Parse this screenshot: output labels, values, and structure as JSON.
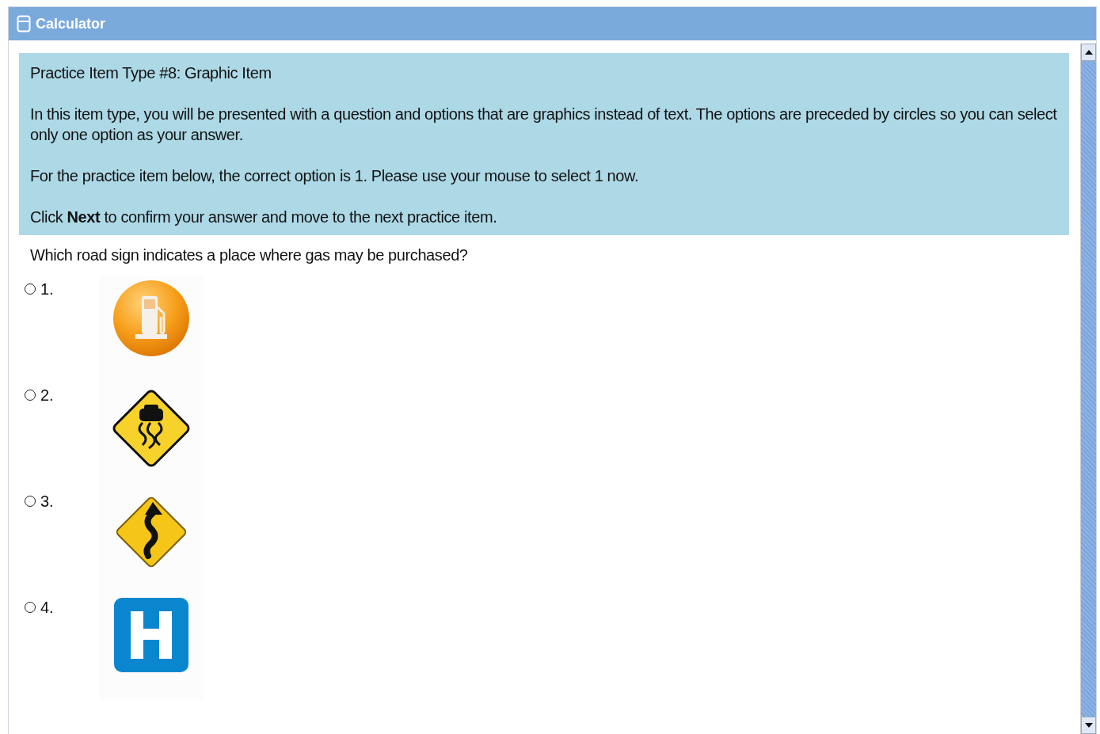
{
  "window": {
    "title": "Calculator"
  },
  "instructions": {
    "heading": "Practice Item Type #8: Graphic Item",
    "paragraphs": [
      "In this item type, you will be presented with a question and options that are graphics instead of text. The options are preceded by circles so you can select only one option as your answer.",
      "For the practice item below, the correct option is 1.  Please use your mouse to select 1 now.",
      "Click **Next** to confirm your answer and move to the next practice item."
    ]
  },
  "question": "Which road sign indicates a place where gas may be purchased?",
  "options": [
    {
      "label": "1.",
      "kind": "gas",
      "selected": false
    },
    {
      "label": "2.",
      "kind": "slippery",
      "selected": false
    },
    {
      "label": "3.",
      "kind": "winding",
      "selected": false
    },
    {
      "label": "4.",
      "kind": "hospital",
      "selected": false
    }
  ]
}
